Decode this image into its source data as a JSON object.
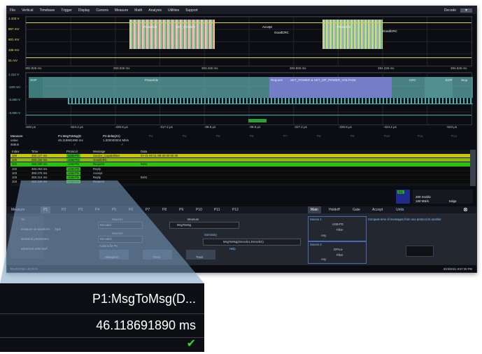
{
  "menu": {
    "items": [
      "File",
      "Vertical",
      "Timebase",
      "Trigger",
      "Display",
      "Cursors",
      "Measure",
      "Math",
      "Analysis",
      "Utilities",
      "Support"
    ],
    "decode_label": "Decode"
  },
  "top_grid": {
    "y_labels": [
      "1.103 V",
      "867 mV",
      "601 mV",
      "335 mV",
      "81 mV"
    ],
    "time_labels": [
      "392.826 ms",
      "393.026 ms",
      "393.426 ms",
      "393.826 ms",
      "394.226 ms",
      "394.626 ms"
    ],
    "decode_texts": [
      "Preamble",
      "SET_POWER",
      "Accept",
      "GoodCRC",
      "Preamble",
      "GoodCRC"
    ]
  },
  "zoom_grid": {
    "y_labels": [
      "1.112 V",
      "-100 mV",
      "-2.000 V",
      "-3.000 V"
    ],
    "time_labels": [
      "-640 μs",
      "-524.4 μs",
      "-425.8 μs",
      "-317.2 μs",
      "-08.6 μs",
      "-08.6 μs",
      "-227.2 μs",
      "-325.8 μs",
      "-424.4 μs",
      "-523 μs"
    ],
    "decode_texts": [
      "SOP",
      "Preamble",
      "Request",
      "SET_POWER & SET_OP_POWER_VOLTAGE",
      "CRC",
      "EOP",
      "Stop"
    ]
  },
  "measure": {
    "heading": "Measure",
    "rows": [
      "value",
      "status"
    ],
    "p1_name": "P1:MsgToMsg(D",
    "p1_value": "46.118691890 ms",
    "p2_name": "P2:delta(Z1)",
    "p2_value": "1.000000004 Mb/s",
    "p_labels": [
      "P3",
      "P4",
      "P5",
      "P6",
      "P7",
      "P8",
      "P9",
      "P10",
      "P11",
      "P12"
    ]
  },
  "decode_table": {
    "headers": [
      "Index",
      "Time",
      "Protocol",
      "Message",
      "Data"
    ],
    "rows": [
      {
        "index": "100",
        "time": "393.127 ms",
        "protocol": "USB-PD",
        "message": "Source_Capabilities",
        "data": "0A 01 90 01 0B 00 00 00 00",
        "color": "#c8c800"
      },
      {
        "index": "100",
        "time": "393.192 ms",
        "protocol": "USB-PD",
        "message": "GoodCRC",
        "data": "",
        "color": "#8fb40c"
      },
      {
        "index": "101",
        "time": "393.200 ms",
        "protocol": "USB-PD",
        "message": "Request",
        "data": "0x01",
        "color": "#2fbf13"
      },
      {
        "index": "102",
        "time": "393.263 ms",
        "protocol": "USB-PD",
        "message": "Reply",
        "data": "",
        "color": "#0c0c0c"
      },
      {
        "index": "103",
        "time": "393.275 ms",
        "protocol": "USB-PD",
        "message": "Accept",
        "data": "",
        "color": "#0c0c0c"
      },
      {
        "index": "103",
        "time": "393.314 ms",
        "protocol": "USB-PD",
        "message": "Reply",
        "data": "0x01",
        "color": "#0c0c0c"
      },
      {
        "index": "104",
        "time": "393.345 ms",
        "protocol": "USB-PD",
        "message": "Request",
        "data": "",
        "color": "#0c0c0c"
      }
    ]
  },
  "channel_box": {
    "c1_label": "C1",
    "c1_values": [
      "116 mV/div",
      "200 μs/div"
    ],
    "c2_values": [
      "540 mV/div",
      "200 μs/div"
    ],
    "timebase": [
      "200 ms/div",
      "100 MS/s",
      "Edge"
    ]
  },
  "panel": {
    "tabs": [
      "Measure",
      "P1",
      "P2",
      "P3",
      "P4",
      "P5",
      "P6",
      "P7",
      "P8",
      "P9",
      "P10",
      "P11",
      "P12",
      "Main",
      "Holdoff",
      "Gate",
      "Accept",
      "Units"
    ],
    "left_items": [
      "On",
      "measure on waveform",
      "statistical parameters",
      "advanced extra stuff"
    ],
    "type_label": "Type",
    "source1_label": "Source1",
    "source1_value": "Decode1",
    "source2_label": "Source2",
    "source2_value": "Decode2",
    "measure_label": "Measure",
    "measure_value": "MsgToMsg",
    "summary_label": "Summary",
    "summary_value": "MsgToMsg(Decode1,Decode2)",
    "help_label": "Help",
    "actions_label": "Actions for P1",
    "action_buttons": [
      "Histogram",
      "Trend",
      "Track"
    ],
    "source1_box": "Source 1",
    "usb_pd": "USB-PD",
    "filter": "Filter",
    "any": "Any",
    "source2_box": "Source 2",
    "pd_value": "DPAux",
    "help_text": "Compute time of messages from one protocol to another",
    "status_left": "TELEDYNE LECROY",
    "status_right": "3/23/2021 9:57:38 PM"
  },
  "zoom": {
    "name": "P1:MsgToMsg(D...",
    "value": "46.118691890 ms",
    "check_icon": "check-icon"
  }
}
